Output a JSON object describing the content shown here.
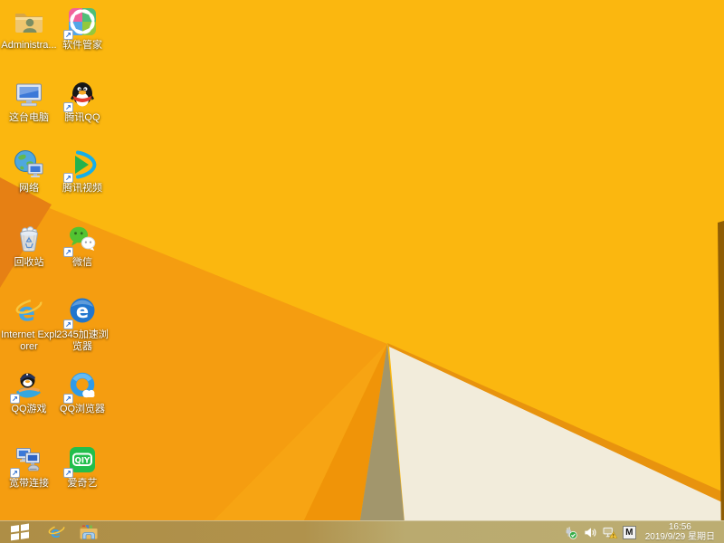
{
  "wallpaper": {
    "colors": {
      "amber": "#FBB70F",
      "lower_orange": "#F59D10",
      "facet_mid": "#F7A413",
      "facet_right": "#F09408",
      "fold_wedge": "#E68014",
      "shadow_khaki": "#A2966C",
      "cream": "#F2ECDB",
      "edge_orange": "#E8930E",
      "right_strip": "#8F5D04"
    }
  },
  "desktop": {
    "icons": [
      {
        "name": "administrator-folder",
        "label": "Administra...",
        "shortcut": false
      },
      {
        "name": "software-manager",
        "label": "软件管家",
        "shortcut": true
      },
      {
        "name": "this-pc",
        "label": "这台电脑",
        "shortcut": false
      },
      {
        "name": "tencent-qq",
        "label": "腾讯QQ",
        "shortcut": true
      },
      {
        "name": "network",
        "label": "网络",
        "shortcut": false
      },
      {
        "name": "tencent-video",
        "label": "腾讯视频",
        "shortcut": true
      },
      {
        "name": "recycle-bin",
        "label": "回收站",
        "shortcut": false
      },
      {
        "name": "wechat",
        "label": "微信",
        "shortcut": true
      },
      {
        "name": "internet-explorer",
        "label": "Internet Explorer",
        "shortcut": false
      },
      {
        "name": "2345-browser",
        "label": "2345加速浏览器",
        "shortcut": true
      },
      {
        "name": "qq-games",
        "label": "QQ游戏",
        "shortcut": true
      },
      {
        "name": "qq-browser",
        "label": "QQ浏览器",
        "shortcut": true
      },
      {
        "name": "broadband-connection",
        "label": "宽带连接",
        "shortcut": true
      },
      {
        "name": "iqiyi",
        "label": "爱奇艺",
        "shortcut": true
      }
    ],
    "icon_art": {
      "ie_letter": "e",
      "browser2345_letter": "e",
      "iqiyi_text": "iQIYI",
      "shortcut_arrow": "↗"
    }
  },
  "taskbar": {
    "colors": {
      "left": "#AE8E46",
      "right": "#BCAD72"
    },
    "pinned": [
      {
        "name": "internet-explorer"
      },
      {
        "name": "file-explorer"
      }
    ],
    "tray": {
      "icons": [
        {
          "name": "usb-safe-remove"
        },
        {
          "name": "volume"
        },
        {
          "name": "network-warning"
        }
      ],
      "ime_badge": "M",
      "time": "16:56",
      "date": "2019/9/29 星期日"
    }
  }
}
